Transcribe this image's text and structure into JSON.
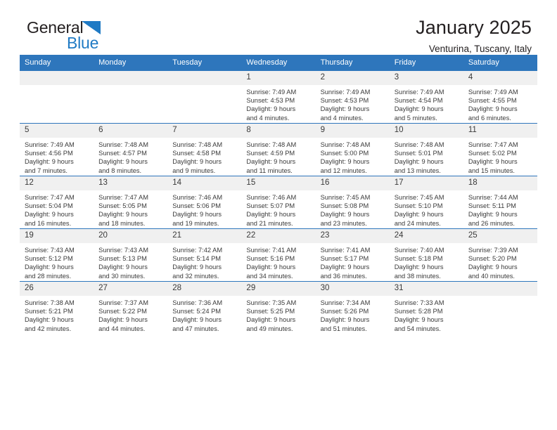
{
  "brand": {
    "name_part1": "General",
    "name_part2": "Blue",
    "triangle_color": "#1f7ac4"
  },
  "header": {
    "title": "January 2025",
    "subtitle": "Venturina, Tuscany, Italy"
  },
  "theme": {
    "header_blue": "#2e76bc",
    "daynum_bg": "#f0f0f0",
    "text": "#3a3a3a"
  },
  "labels": {
    "sunrise": "Sunrise:",
    "sunset": "Sunset:",
    "daylight": "Daylight:"
  },
  "weekday_headers": [
    "Sunday",
    "Monday",
    "Tuesday",
    "Wednesday",
    "Thursday",
    "Friday",
    "Saturday"
  ],
  "weeks": [
    [
      {
        "day": "",
        "blank": true,
        "sunrise": "",
        "sunset": "",
        "daylight_line1": "",
        "daylight_line2": ""
      },
      {
        "day": "",
        "blank": true,
        "sunrise": "",
        "sunset": "",
        "daylight_line1": "",
        "daylight_line2": ""
      },
      {
        "day": "",
        "blank": true,
        "sunrise": "",
        "sunset": "",
        "daylight_line1": "",
        "daylight_line2": ""
      },
      {
        "day": "1",
        "blank": false,
        "sunrise": "Sunrise: 7:49 AM",
        "sunset": "Sunset: 4:53 PM",
        "daylight_line1": "Daylight: 9 hours",
        "daylight_line2": "and 4 minutes."
      },
      {
        "day": "2",
        "blank": false,
        "sunrise": "Sunrise: 7:49 AM",
        "sunset": "Sunset: 4:53 PM",
        "daylight_line1": "Daylight: 9 hours",
        "daylight_line2": "and 4 minutes."
      },
      {
        "day": "3",
        "blank": false,
        "sunrise": "Sunrise: 7:49 AM",
        "sunset": "Sunset: 4:54 PM",
        "daylight_line1": "Daylight: 9 hours",
        "daylight_line2": "and 5 minutes."
      },
      {
        "day": "4",
        "blank": false,
        "sunrise": "Sunrise: 7:49 AM",
        "sunset": "Sunset: 4:55 PM",
        "daylight_line1": "Daylight: 9 hours",
        "daylight_line2": "and 6 minutes."
      }
    ],
    [
      {
        "day": "5",
        "blank": false,
        "sunrise": "Sunrise: 7:49 AM",
        "sunset": "Sunset: 4:56 PM",
        "daylight_line1": "Daylight: 9 hours",
        "daylight_line2": "and 7 minutes."
      },
      {
        "day": "6",
        "blank": false,
        "sunrise": "Sunrise: 7:48 AM",
        "sunset": "Sunset: 4:57 PM",
        "daylight_line1": "Daylight: 9 hours",
        "daylight_line2": "and 8 minutes."
      },
      {
        "day": "7",
        "blank": false,
        "sunrise": "Sunrise: 7:48 AM",
        "sunset": "Sunset: 4:58 PM",
        "daylight_line1": "Daylight: 9 hours",
        "daylight_line2": "and 9 minutes."
      },
      {
        "day": "8",
        "blank": false,
        "sunrise": "Sunrise: 7:48 AM",
        "sunset": "Sunset: 4:59 PM",
        "daylight_line1": "Daylight: 9 hours",
        "daylight_line2": "and 11 minutes."
      },
      {
        "day": "9",
        "blank": false,
        "sunrise": "Sunrise: 7:48 AM",
        "sunset": "Sunset: 5:00 PM",
        "daylight_line1": "Daylight: 9 hours",
        "daylight_line2": "and 12 minutes."
      },
      {
        "day": "10",
        "blank": false,
        "sunrise": "Sunrise: 7:48 AM",
        "sunset": "Sunset: 5:01 PM",
        "daylight_line1": "Daylight: 9 hours",
        "daylight_line2": "and 13 minutes."
      },
      {
        "day": "11",
        "blank": false,
        "sunrise": "Sunrise: 7:47 AM",
        "sunset": "Sunset: 5:02 PM",
        "daylight_line1": "Daylight: 9 hours",
        "daylight_line2": "and 15 minutes."
      }
    ],
    [
      {
        "day": "12",
        "blank": false,
        "sunrise": "Sunrise: 7:47 AM",
        "sunset": "Sunset: 5:04 PM",
        "daylight_line1": "Daylight: 9 hours",
        "daylight_line2": "and 16 minutes."
      },
      {
        "day": "13",
        "blank": false,
        "sunrise": "Sunrise: 7:47 AM",
        "sunset": "Sunset: 5:05 PM",
        "daylight_line1": "Daylight: 9 hours",
        "daylight_line2": "and 18 minutes."
      },
      {
        "day": "14",
        "blank": false,
        "sunrise": "Sunrise: 7:46 AM",
        "sunset": "Sunset: 5:06 PM",
        "daylight_line1": "Daylight: 9 hours",
        "daylight_line2": "and 19 minutes."
      },
      {
        "day": "15",
        "blank": false,
        "sunrise": "Sunrise: 7:46 AM",
        "sunset": "Sunset: 5:07 PM",
        "daylight_line1": "Daylight: 9 hours",
        "daylight_line2": "and 21 minutes."
      },
      {
        "day": "16",
        "blank": false,
        "sunrise": "Sunrise: 7:45 AM",
        "sunset": "Sunset: 5:08 PM",
        "daylight_line1": "Daylight: 9 hours",
        "daylight_line2": "and 23 minutes."
      },
      {
        "day": "17",
        "blank": false,
        "sunrise": "Sunrise: 7:45 AM",
        "sunset": "Sunset: 5:10 PM",
        "daylight_line1": "Daylight: 9 hours",
        "daylight_line2": "and 24 minutes."
      },
      {
        "day": "18",
        "blank": false,
        "sunrise": "Sunrise: 7:44 AM",
        "sunset": "Sunset: 5:11 PM",
        "daylight_line1": "Daylight: 9 hours",
        "daylight_line2": "and 26 minutes."
      }
    ],
    [
      {
        "day": "19",
        "blank": false,
        "sunrise": "Sunrise: 7:43 AM",
        "sunset": "Sunset: 5:12 PM",
        "daylight_line1": "Daylight: 9 hours",
        "daylight_line2": "and 28 minutes."
      },
      {
        "day": "20",
        "blank": false,
        "sunrise": "Sunrise: 7:43 AM",
        "sunset": "Sunset: 5:13 PM",
        "daylight_line1": "Daylight: 9 hours",
        "daylight_line2": "and 30 minutes."
      },
      {
        "day": "21",
        "blank": false,
        "sunrise": "Sunrise: 7:42 AM",
        "sunset": "Sunset: 5:14 PM",
        "daylight_line1": "Daylight: 9 hours",
        "daylight_line2": "and 32 minutes."
      },
      {
        "day": "22",
        "blank": false,
        "sunrise": "Sunrise: 7:41 AM",
        "sunset": "Sunset: 5:16 PM",
        "daylight_line1": "Daylight: 9 hours",
        "daylight_line2": "and 34 minutes."
      },
      {
        "day": "23",
        "blank": false,
        "sunrise": "Sunrise: 7:41 AM",
        "sunset": "Sunset: 5:17 PM",
        "daylight_line1": "Daylight: 9 hours",
        "daylight_line2": "and 36 minutes."
      },
      {
        "day": "24",
        "blank": false,
        "sunrise": "Sunrise: 7:40 AM",
        "sunset": "Sunset: 5:18 PM",
        "daylight_line1": "Daylight: 9 hours",
        "daylight_line2": "and 38 minutes."
      },
      {
        "day": "25",
        "blank": false,
        "sunrise": "Sunrise: 7:39 AM",
        "sunset": "Sunset: 5:20 PM",
        "daylight_line1": "Daylight: 9 hours",
        "daylight_line2": "and 40 minutes."
      }
    ],
    [
      {
        "day": "26",
        "blank": false,
        "sunrise": "Sunrise: 7:38 AM",
        "sunset": "Sunset: 5:21 PM",
        "daylight_line1": "Daylight: 9 hours",
        "daylight_line2": "and 42 minutes."
      },
      {
        "day": "27",
        "blank": false,
        "sunrise": "Sunrise: 7:37 AM",
        "sunset": "Sunset: 5:22 PM",
        "daylight_line1": "Daylight: 9 hours",
        "daylight_line2": "and 44 minutes."
      },
      {
        "day": "28",
        "blank": false,
        "sunrise": "Sunrise: 7:36 AM",
        "sunset": "Sunset: 5:24 PM",
        "daylight_line1": "Daylight: 9 hours",
        "daylight_line2": "and 47 minutes."
      },
      {
        "day": "29",
        "blank": false,
        "sunrise": "Sunrise: 7:35 AM",
        "sunset": "Sunset: 5:25 PM",
        "daylight_line1": "Daylight: 9 hours",
        "daylight_line2": "and 49 minutes."
      },
      {
        "day": "30",
        "blank": false,
        "sunrise": "Sunrise: 7:34 AM",
        "sunset": "Sunset: 5:26 PM",
        "daylight_line1": "Daylight: 9 hours",
        "daylight_line2": "and 51 minutes."
      },
      {
        "day": "31",
        "blank": false,
        "sunrise": "Sunrise: 7:33 AM",
        "sunset": "Sunset: 5:28 PM",
        "daylight_line1": "Daylight: 9 hours",
        "daylight_line2": "and 54 minutes."
      },
      {
        "day": "",
        "blank": true,
        "sunrise": "",
        "sunset": "",
        "daylight_line1": "",
        "daylight_line2": ""
      }
    ]
  ]
}
